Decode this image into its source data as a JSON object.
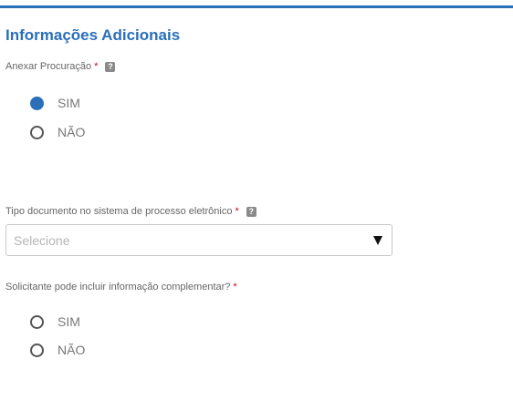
{
  "section": {
    "title": "Informações Adicionais"
  },
  "fields": {
    "anexar_procuracao": {
      "label": "Anexar Procuração",
      "required_mark": "*",
      "help_icon": "question-mark-icon",
      "options": [
        {
          "label": "SIM",
          "checked": true
        },
        {
          "label": "NÃO",
          "checked": false
        }
      ]
    },
    "tipo_documento": {
      "label": "Tipo documento no sistema de processo eletrônico",
      "required_mark": "*",
      "help_icon": "question-mark-icon",
      "placeholder": "Selecione",
      "caret_icon": "triangle-down-icon"
    },
    "solicitante_info": {
      "label": "Solicitante pode incluir informação complementar?",
      "required_mark": "*",
      "options": [
        {
          "label": "SIM",
          "checked": false
        },
        {
          "label": "NÃO",
          "checked": false
        }
      ]
    }
  },
  "colors": {
    "accent": "#2a6fb8",
    "required": "#d0021b",
    "label_text": "#666666",
    "placeholder_text": "#b5b5b5"
  }
}
